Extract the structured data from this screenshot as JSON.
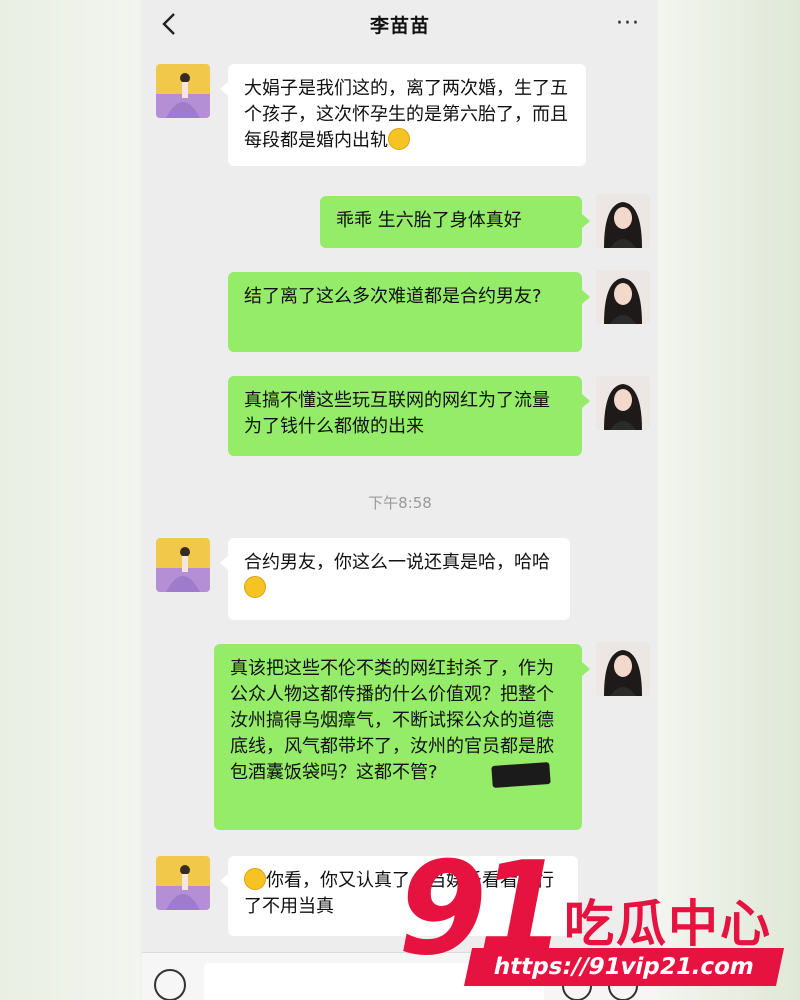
{
  "header": {
    "title": "李苗苗",
    "more_label": "···"
  },
  "messages": [
    {
      "side": "left",
      "text": "大娟子是我们这的，离了两次婚，生了五个孩子，这次怀孕生的是第六胎了，而且每段都是婚内出轨"
    },
    {
      "side": "right",
      "text": "乖乖 生六胎了身体真好"
    },
    {
      "side": "right",
      "text": "结了离了这么多次难道都是合约男友?"
    },
    {
      "side": "right",
      "text": "真搞不懂这些玩互联网的网红为了流量为了钱什么都做的出来"
    },
    {
      "side": "left",
      "text": "合约男友，你这么一说还真是哈，哈哈"
    },
    {
      "side": "right",
      "text": "真该把这些不伦不类的网红封杀了，作为公众人物这都传播的什么价值观？把整个汝州搞得乌烟瘴气，不断试探公众的道德底线，风气都带坏了，汝州的官员都是脓包酒囊饭袋吗？这都不管?"
    },
    {
      "side": "left",
      "text": "你看，你又认真了，当娱乐看看就行了不用当真"
    }
  ],
  "timestamp": "下午8:58",
  "watermark": {
    "number": "91",
    "text": "吃瓜中心",
    "url": "https://91vip21.com"
  },
  "colors": {
    "green_bubble": "#95ec69",
    "white_bubble": "#ffffff",
    "watermark_red": "#e6123f"
  }
}
